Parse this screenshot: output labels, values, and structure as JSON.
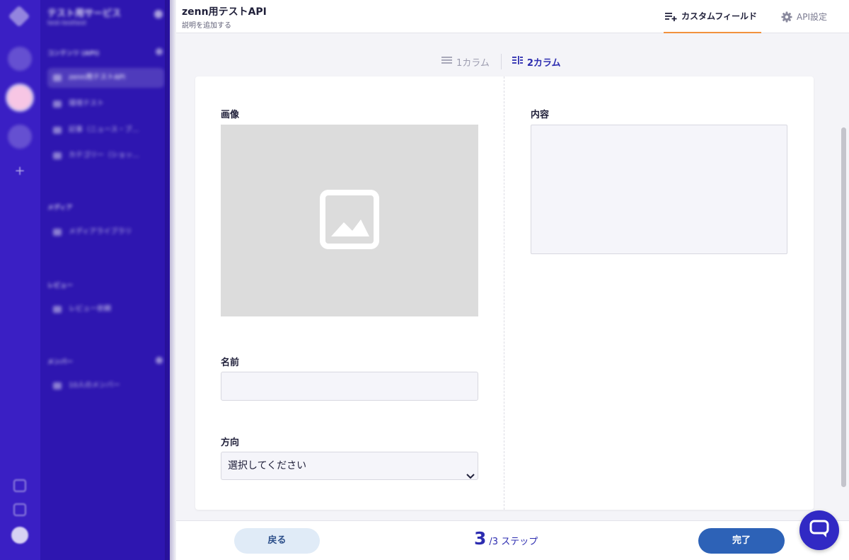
{
  "sidebar": {
    "service_name": "テスト用サービス",
    "service_id": "test-testtest",
    "sections": [
      {
        "label": "コンテンツ (API)",
        "items": [
          "zenn用テストAPI",
          "環境テスト",
          "記事（ニュース・ブ…",
          "カテゴリー（ショッ…"
        ]
      },
      {
        "label": "メディア",
        "items": [
          "メディアライブラリ"
        ]
      },
      {
        "label": "レビュー",
        "items": [
          "レビュー依頼"
        ]
      },
      {
        "label": "メンバー",
        "items": [
          "10人のメンバー"
        ]
      }
    ]
  },
  "header": {
    "title": "zenn用テストAPI",
    "description": "説明を追加する",
    "tabs": [
      {
        "label": "カスタムフィールド",
        "icon": "custom-field-icon",
        "active": true
      },
      {
        "label": "API設定",
        "icon": "gear-icon",
        "active": false
      }
    ]
  },
  "layout_switch": {
    "one_column": "1カラム",
    "two_column": "2カラム",
    "selected": "2カラム"
  },
  "form": {
    "left": {
      "image_label": "画像",
      "name_label": "名前",
      "name_value": "",
      "direction_label": "方向",
      "direction_value": "選択してください"
    },
    "right": {
      "content_label": "内容",
      "content_value": ""
    }
  },
  "footer": {
    "back_label": "戻る",
    "step_current": "3",
    "step_total": "/3 ステップ",
    "done_label": "完了"
  },
  "colors": {
    "rail": "#3a1fc4",
    "sidebar": "#2e16b0",
    "accent": "#2c2cb0",
    "tab_underline": "#f1913d",
    "primary_button": "#2d62b7"
  }
}
